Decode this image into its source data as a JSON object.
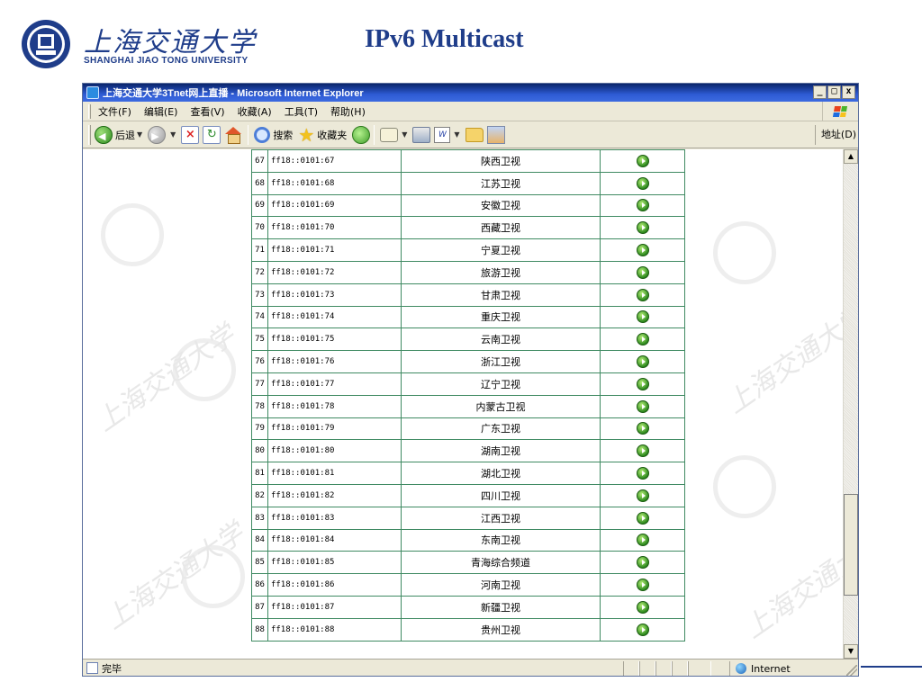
{
  "slide": {
    "logo_cn": "上海交通大学",
    "logo_en": "SHANGHAI JIAO TONG UNIVERSITY",
    "title": "IPv6 Multicast"
  },
  "window": {
    "title": "上海交通大学3Tnet网上直播 - Microsoft Internet Explorer",
    "buttons": {
      "minimize": "_",
      "maximize": "□",
      "close": "x"
    }
  },
  "menubar": {
    "items": [
      "文件(F)",
      "编辑(E)",
      "查看(V)",
      "收藏(A)",
      "工具(T)",
      "帮助(H)"
    ]
  },
  "toolbar": {
    "back": "后退",
    "search": "搜索",
    "favorites": "收藏夹",
    "address": "地址(D)",
    "edit_icon_letter": "W"
  },
  "channels": [
    {
      "no": "67",
      "addr": "ff18::0101:67",
      "name": "陕西卫视"
    },
    {
      "no": "68",
      "addr": "ff18::0101:68",
      "name": "江苏卫视"
    },
    {
      "no": "69",
      "addr": "ff18::0101:69",
      "name": "安徽卫视"
    },
    {
      "no": "70",
      "addr": "ff18::0101:70",
      "name": "西藏卫视"
    },
    {
      "no": "71",
      "addr": "ff18::0101:71",
      "name": "宁夏卫视"
    },
    {
      "no": "72",
      "addr": "ff18::0101:72",
      "name": "旅游卫视"
    },
    {
      "no": "73",
      "addr": "ff18::0101:73",
      "name": "甘肃卫视"
    },
    {
      "no": "74",
      "addr": "ff18::0101:74",
      "name": "重庆卫视"
    },
    {
      "no": "75",
      "addr": "ff18::0101:75",
      "name": "云南卫视"
    },
    {
      "no": "76",
      "addr": "ff18::0101:76",
      "name": "浙江卫视"
    },
    {
      "no": "77",
      "addr": "ff18::0101:77",
      "name": "辽宁卫视"
    },
    {
      "no": "78",
      "addr": "ff18::0101:78",
      "name": "内蒙古卫视"
    },
    {
      "no": "79",
      "addr": "ff18::0101:79",
      "name": "广东卫视"
    },
    {
      "no": "80",
      "addr": "ff18::0101:80",
      "name": "湖南卫视"
    },
    {
      "no": "81",
      "addr": "ff18::0101:81",
      "name": "湖北卫视"
    },
    {
      "no": "82",
      "addr": "ff18::0101:82",
      "name": "四川卫视"
    },
    {
      "no": "83",
      "addr": "ff18::0101:83",
      "name": "江西卫视"
    },
    {
      "no": "84",
      "addr": "ff18::0101:84",
      "name": "东南卫视"
    },
    {
      "no": "85",
      "addr": "ff18::0101:85",
      "name": "青海综合频道"
    },
    {
      "no": "86",
      "addr": "ff18::0101:86",
      "name": "河南卫视"
    },
    {
      "no": "87",
      "addr": "ff18::0101:87",
      "name": "新疆卫视"
    },
    {
      "no": "88",
      "addr": "ff18::0101:88",
      "name": "贵州卫视"
    }
  ],
  "statusbar": {
    "status": "完毕",
    "zone": "Internet"
  },
  "colors": {
    "brand_blue": "#1f3d8a",
    "table_border": "#3f8a62",
    "status_green": "#2d8a1e"
  }
}
